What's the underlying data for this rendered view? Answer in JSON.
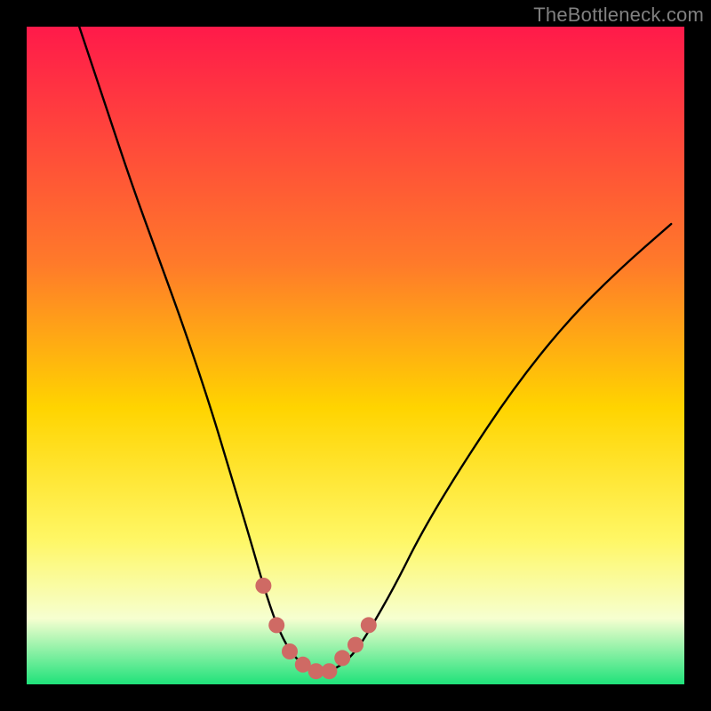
{
  "watermark": "TheBottleneck.com",
  "colors": {
    "gradient_top": "#ff1a4a",
    "gradient_mid_upper": "#ff7a2a",
    "gradient_mid": "#ffd400",
    "gradient_mid_lower": "#fff765",
    "gradient_lower": "#f6ffd0",
    "gradient_bottom": "#1fe27a",
    "curve": "#000000",
    "marker": "#cf6a64",
    "frame": "#000000"
  },
  "chart_data": {
    "type": "line",
    "title": "",
    "xlabel": "",
    "ylabel": "",
    "xlim": [
      0,
      100
    ],
    "ylim": [
      0,
      100
    ],
    "series": [
      {
        "name": "bottleneck-curve",
        "x": [
          8,
          12,
          16,
          20,
          24,
          28,
          31,
          34,
          36,
          38,
          40,
          42,
          44,
          46,
          48,
          50,
          52,
          56,
          60,
          66,
          74,
          82,
          90,
          98
        ],
        "y": [
          100,
          88,
          76,
          65,
          54,
          42,
          32,
          22,
          15,
          9,
          5,
          3,
          2,
          2,
          3,
          5,
          8,
          15,
          23,
          33,
          45,
          55,
          63,
          70
        ]
      }
    ],
    "markers": {
      "name": "highlight-points",
      "x": [
        36,
        38,
        40,
        42,
        44,
        46,
        48,
        50,
        52
      ],
      "y": [
        15,
        9,
        5,
        3,
        2,
        2,
        4,
        6,
        9
      ]
    }
  }
}
